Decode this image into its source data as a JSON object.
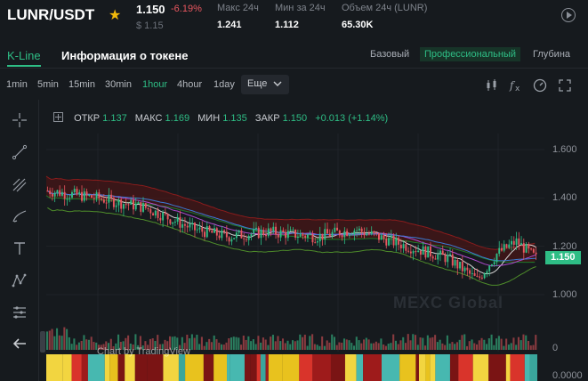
{
  "header": {
    "pair": "LUNR/USDT",
    "last_price": "1.150",
    "change_pct": "-6.19%",
    "usd_price": "$ 1.15",
    "stats": [
      {
        "label": "Макс 24ч",
        "value": "1.241"
      },
      {
        "label": "Мин за 24ч",
        "value": "1.112"
      },
      {
        "label": "Объем 24ч (LUNR)",
        "value": "65.30K"
      }
    ]
  },
  "tabs": {
    "kline": "K-Line",
    "token_info": "Информация о токене",
    "views": [
      "Базовый",
      "Профессиональный",
      "Глубина"
    ],
    "active_view": "Профессиональный"
  },
  "toolbar": {
    "intervals": [
      "1min",
      "5min",
      "15min",
      "30min",
      "1hour",
      "4hour",
      "1day"
    ],
    "active_interval": "1hour",
    "more_label": "Еще",
    "icons": [
      "candle-type-icon",
      "indicator-fx-icon",
      "settings-gauge-icon",
      "fullscreen-icon"
    ]
  },
  "drawing_tools": [
    "crosshair-icon",
    "trend-line-icon",
    "fib-tool-icon",
    "brush-icon",
    "text-tool-icon",
    "pattern-icon",
    "measure-icon",
    "back-arrow-icon"
  ],
  "ohlc": {
    "open_label": "ОТКР",
    "open": "1.137",
    "high_label": "МАКС",
    "high": "1.169",
    "low_label": "МИН",
    "low": "1.135",
    "close_label": "ЗАКР",
    "close": "1.150",
    "change": "+0.013 (+1.14%)"
  },
  "axis_ticks": [
    "1.600",
    "1.400",
    "1.200",
    "1.000"
  ],
  "current_price_tag": "1.150",
  "volume_axis_label": "0",
  "lower_axis_label": "0.0000",
  "watermark": "MEXC Global",
  "tv_watermark": "Chart by TradingView",
  "colors": {
    "up": "#2ebd85",
    "down": "#e8565f",
    "accent_star": "#f0b90b",
    "background": "#161a1e"
  }
}
